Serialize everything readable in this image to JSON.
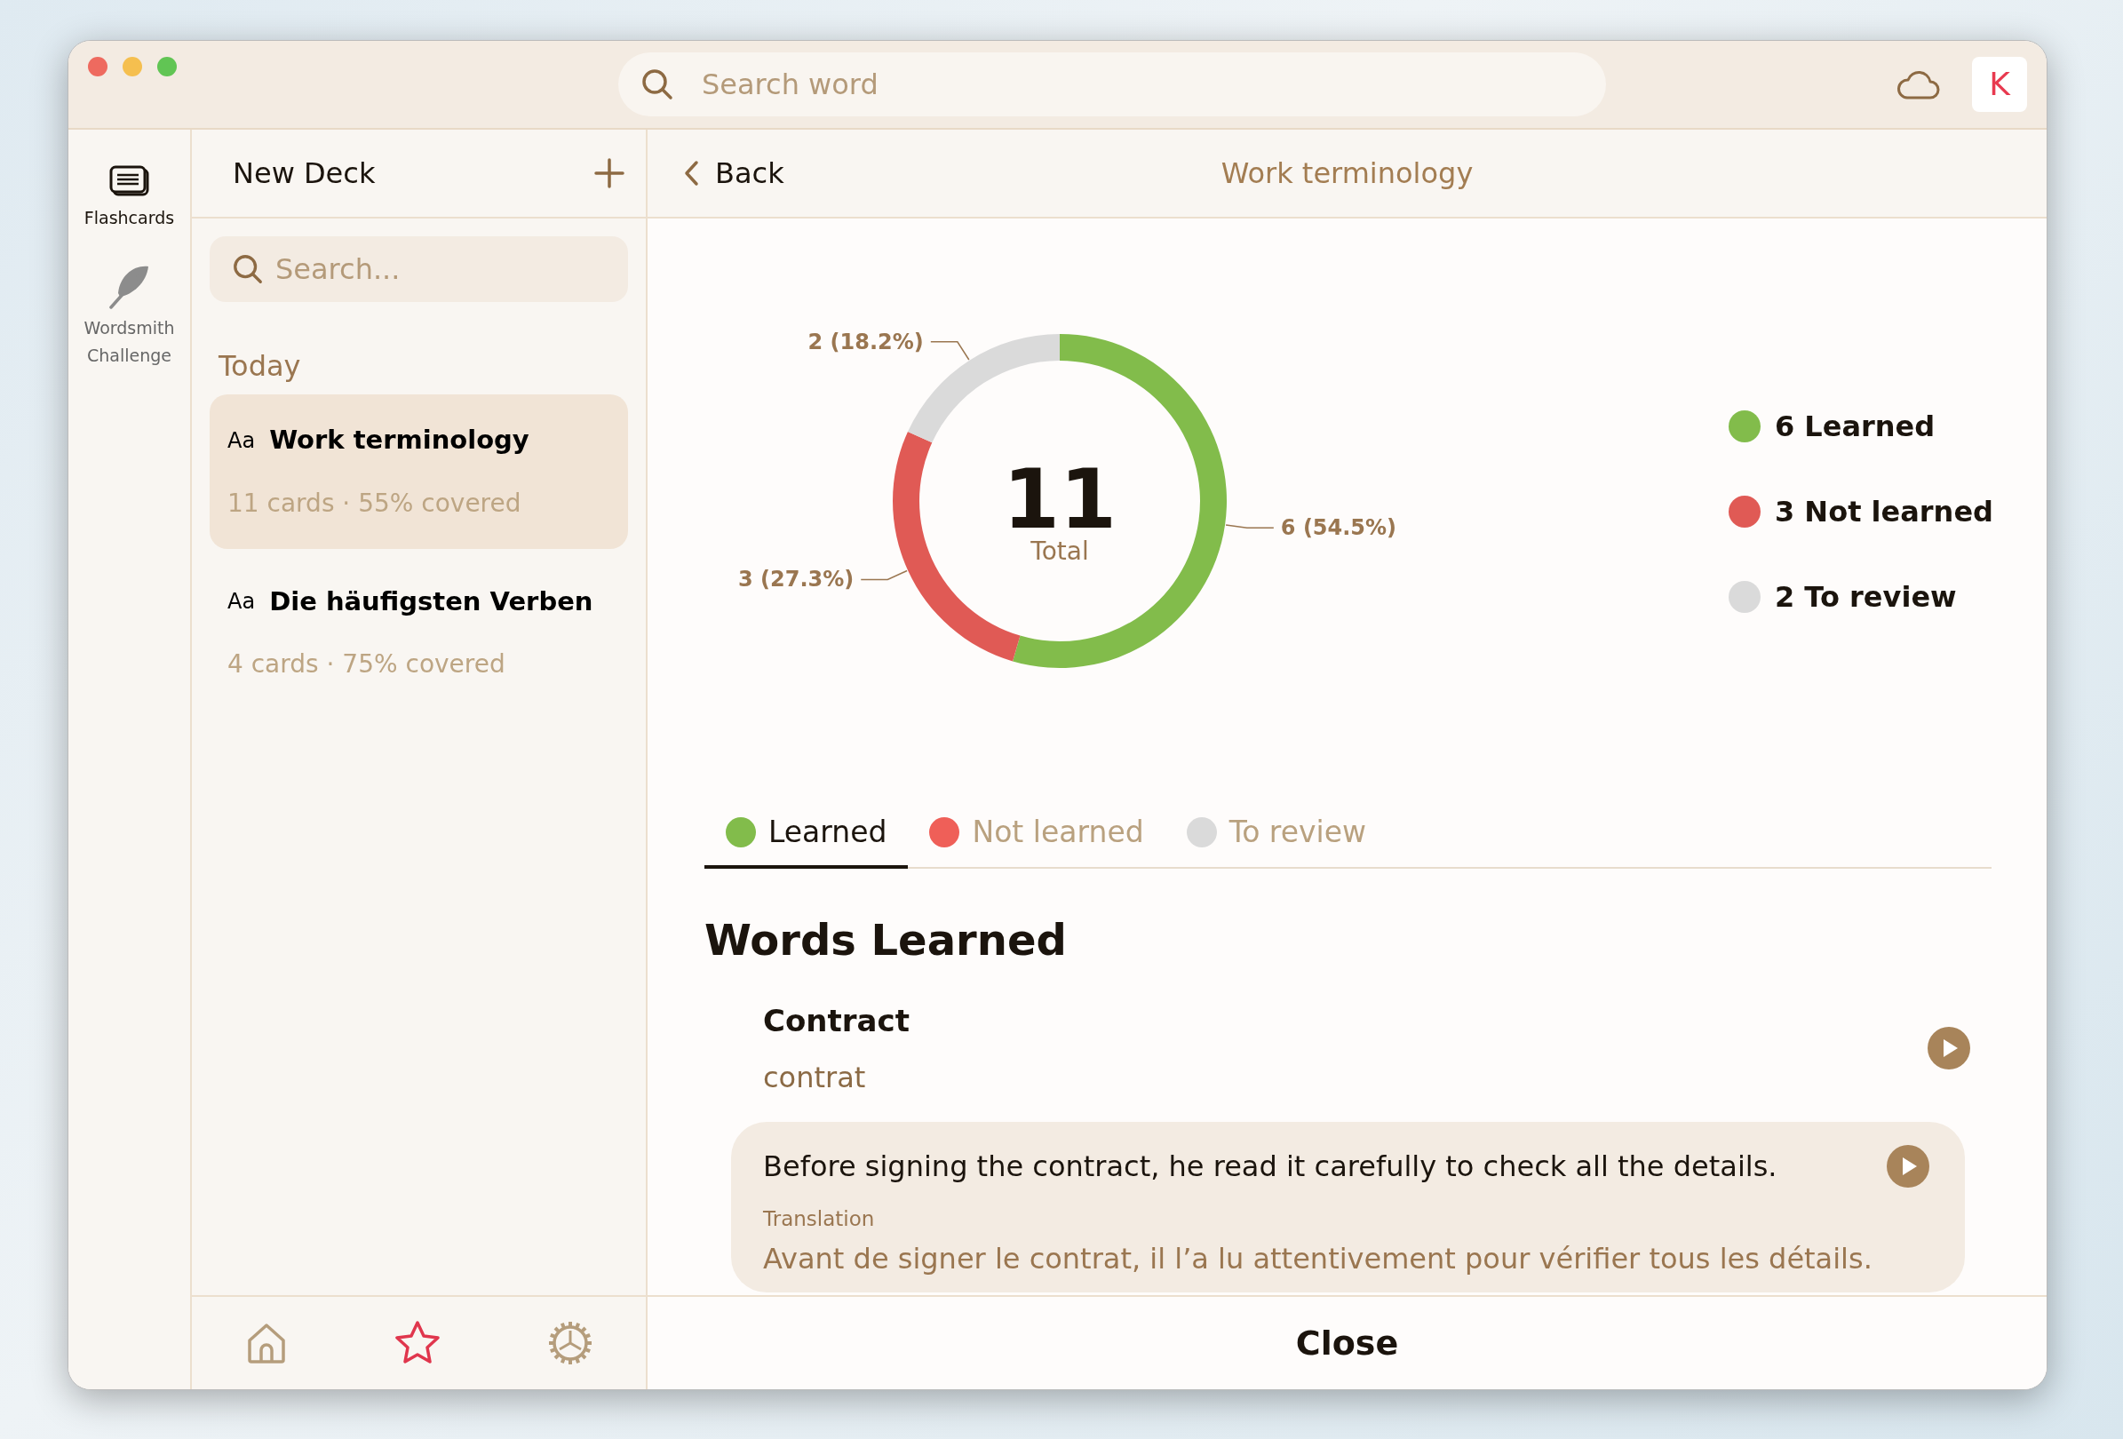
{
  "window": {
    "controls": [
      {
        "color": "#ee6a5f"
      },
      {
        "color": "#f5bf4f"
      },
      {
        "color": "#61c554"
      }
    ]
  },
  "search": {
    "placeholder": "Search word"
  },
  "avatar": "K",
  "rail": [
    {
      "kind": "flashcards",
      "label": "Flashcards",
      "selected": true
    },
    {
      "kind": "feather",
      "label": "Wordsmith Challenge",
      "selected": false
    }
  ],
  "decks": {
    "title": "New Deck",
    "search_placeholder": "Search...",
    "section": "Today",
    "items": [
      {
        "icon_text": "Aa",
        "title": "Work terminology",
        "subtitle": "11 cards · 55% covered",
        "selected": true
      },
      {
        "icon_text": "Aa",
        "title": "Die häufigsten Verben",
        "subtitle": "4 cards · 75% covered",
        "selected": false
      }
    ]
  },
  "bottom_nav": [
    {
      "kind": "home",
      "selected": false
    },
    {
      "kind": "star",
      "selected": true
    },
    {
      "kind": "settings",
      "selected": false
    }
  ],
  "detail": {
    "back": "Back",
    "title": "Work terminology",
    "chart_data": {
      "type": "donut",
      "categories": [
        "6 (54.5%)",
        "3 (27.3%)",
        "2 (18.2%)"
      ],
      "series": [
        {
          "values": [
            6,
            3,
            2
          ],
          "colors": [
            "#82bc4b",
            "#e05a55",
            "#dadada"
          ]
        }
      ]
    },
    "total": "11",
    "total_label": "Total",
    "legend": [
      {
        "label": "6 Learned",
        "color": "#82bc4b"
      },
      {
        "label": "3 Not learned",
        "color": "#e05a55"
      },
      {
        "label": "2 To review",
        "color": "#dadada"
      }
    ],
    "tabs": [
      {
        "label": "Learned",
        "color": "#82bc4b",
        "selected": true
      },
      {
        "label": "Not learned",
        "color": "#ef5f58",
        "selected": false
      },
      {
        "label": "To review",
        "color": "#dadada",
        "selected": false
      }
    ],
    "heading": "Words Learned",
    "words": [
      {
        "term": "Contract",
        "translation": "contrat",
        "example": "Before signing the contract, he read it carefully to check all the details.",
        "example_label": "Translation",
        "example_translation": "Avant de signer le contrat, il l’a lu attentivement pour vérifier tous les détails."
      }
    ],
    "close": "Close"
  }
}
